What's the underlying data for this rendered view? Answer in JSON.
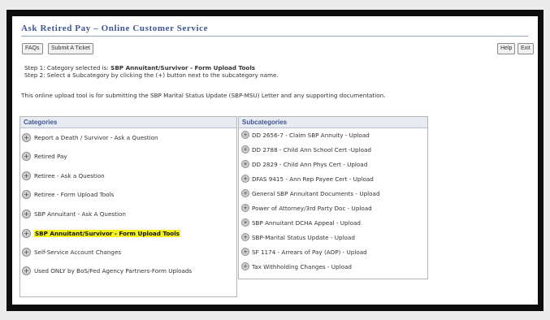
{
  "header": {
    "title": "Ask Retired Pay – Online Customer Service"
  },
  "toolbar": {
    "faqs": "FAQs",
    "submit_ticket": "Submit A Ticket",
    "help": "Help",
    "exit": "Exit"
  },
  "steps": {
    "step1_prefix": "Step 1: Category selected is:",
    "step1_value": "SBP Annuitant/Survivor - Form Upload Tools",
    "step2": "Step 2: Select a Subcategory by clicking the (+) button next to the subcategory name."
  },
  "description": "This online upload tool is for submitting the SBP Marital Status Update (SBP-MSU) Letter and any supporting documentation.",
  "categories": {
    "header": "Categories",
    "items": [
      {
        "label": "Report a Death / Survivor - Ask a Question"
      },
      {
        "label": "Retired Pay"
      },
      {
        "label": "Retiree - Ask a Question"
      },
      {
        "label": "Retiree - Form Upload Tools"
      },
      {
        "label": "SBP Annuitant - Ask A Question"
      },
      {
        "label": "SBP Annuitant/Survivor - Form Upload Tools"
      },
      {
        "label": "Self-Service Account Changes"
      },
      {
        "label": "Used ONLY by BoS/Fed Agency Partners-Form Uploads"
      }
    ],
    "selected_index": 5
  },
  "subcategories": {
    "header": "Subcategories",
    "items": [
      {
        "label": "DD 2656-7 - Claim SBP Annuity - Upload"
      },
      {
        "label": "DD 2788 - Child Ann School Cert -Upload"
      },
      {
        "label": "DD 2829 - Child Ann Phys Cert - Upload"
      },
      {
        "label": "DFAS 9415 - Ann Rep Payee Cert - Upload"
      },
      {
        "label": "General SBP Annuitant Documents - Upload"
      },
      {
        "label": "Power of Attorney/3rd Party Doc - Upload"
      },
      {
        "label": "SBP Annuitant DCHA Appeal - Upload"
      },
      {
        "label": "SBP-Marital Status Update - Upload"
      },
      {
        "label": "SF 1174 - Arrears of Pay (AOP) - Upload"
      },
      {
        "label": "Tax Withholding Changes - Upload"
      }
    ]
  },
  "icons": {
    "expand": "+"
  },
  "colors": {
    "title": "#3e5693",
    "highlight": "#f5f21e"
  }
}
